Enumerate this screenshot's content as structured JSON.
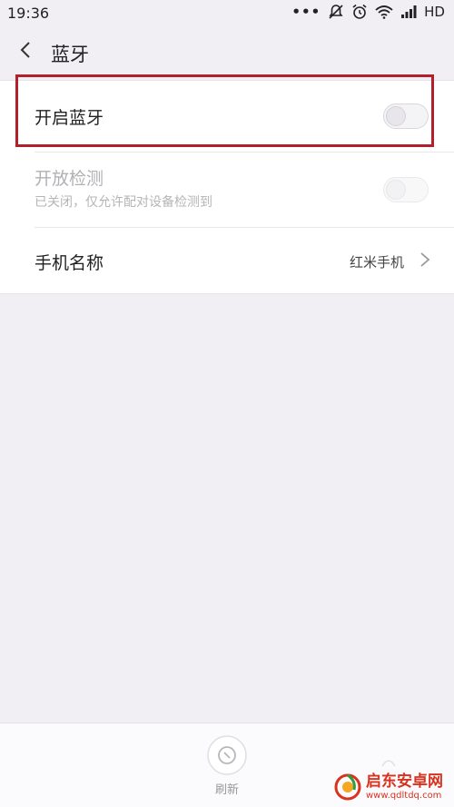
{
  "status_bar": {
    "time": "19:36",
    "dots": "•••",
    "network": "HD"
  },
  "header": {
    "title": "蓝牙"
  },
  "settings": {
    "bluetooth": {
      "label": "开启蓝牙",
      "enabled": false
    },
    "discoverable": {
      "label": "开放检测",
      "sublabel": "已关闭，仅允许配对设备检测到",
      "enabled": false,
      "disabled": true
    },
    "device_name": {
      "label": "手机名称",
      "value": "红米手机"
    }
  },
  "bottom_bar": {
    "refresh_label": "刷新"
  },
  "watermark": {
    "name": "启东安卓网",
    "url": "www.qdltdq.com"
  },
  "colors": {
    "background": "#f1eff3",
    "card": "#ffffff",
    "highlight": "#b3202b",
    "watermark": "#d9321f"
  },
  "icons": [
    "back-icon",
    "mute-icon",
    "alarm-icon",
    "wifi-icon",
    "signal-icon",
    "chevron-right-icon",
    "refresh-icon"
  ]
}
